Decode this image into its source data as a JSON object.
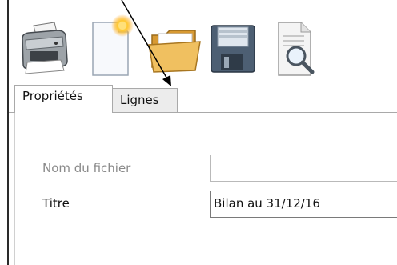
{
  "toolbar": {
    "buttons": [
      {
        "icon": "printer-icon"
      },
      {
        "icon": "new-document-icon"
      },
      {
        "icon": "open-folder-icon"
      },
      {
        "icon": "save-floppy-icon"
      },
      {
        "icon": "print-preview-icon"
      }
    ]
  },
  "tabs": {
    "proprietes": "Propriétés",
    "lignes": "Lignes"
  },
  "form": {
    "nom_label": "Nom du fichier",
    "nom_value": "",
    "titre_label": "Titre",
    "titre_value": "Bilan au 31/12/16"
  },
  "colors": {
    "tab_active": "#ffffff",
    "tab_inactive": "#ececec",
    "border": "#a9a9a9",
    "disabled_text": "#8a8a8a"
  }
}
